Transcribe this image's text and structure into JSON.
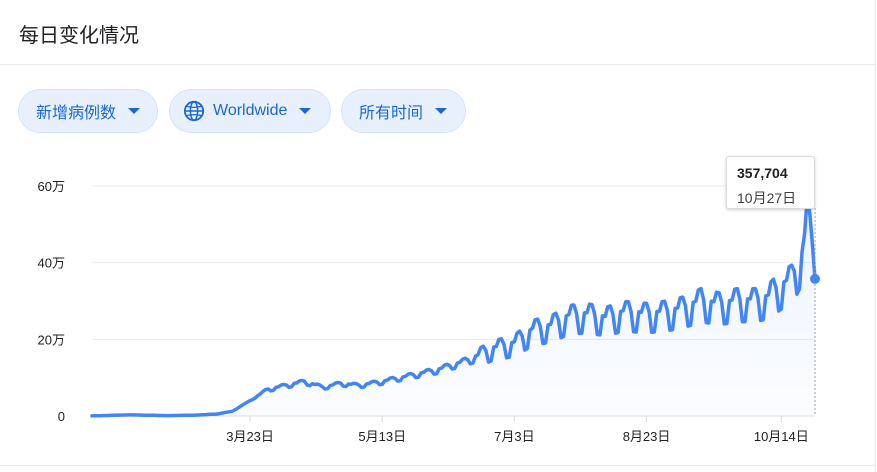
{
  "header": {
    "title": "每日变化情况"
  },
  "filters": {
    "metric": "新增病例数",
    "region": "Worldwide",
    "range": "所有时间"
  },
  "colors": {
    "line": "#4285f4",
    "accent": "#1967d2",
    "chip_bg": "#e8f0fe"
  },
  "icons": {
    "region": "globe-icon",
    "dropdown": "caret-down-icon"
  },
  "tooltip": {
    "value": "357,704",
    "date": "10月27日"
  },
  "chart_data": {
    "type": "area",
    "title": "",
    "xlabel": "",
    "ylabel": "",
    "x_ticks": [
      "3月23日",
      "5月13日",
      "7月3日",
      "8月23日",
      "10月14日"
    ],
    "y_ticks": [
      {
        "value": 0,
        "label": "0"
      },
      {
        "value": 200000,
        "label": "20万"
      },
      {
        "value": 400000,
        "label": "40万"
      },
      {
        "value": 600000,
        "label": "60万"
      }
    ],
    "ylim": [
      0,
      600000
    ],
    "xlim": [
      "2020-01-22",
      "2020-10-27"
    ],
    "grid": "horizontal",
    "series": [
      {
        "x": [
          "2020-01-22",
          "2020-02-05",
          "2020-02-13",
          "2020-02-20",
          "2020-03-01",
          "2020-03-10",
          "2020-03-16",
          "2020-03-23",
          "2020-03-30",
          "2020-04-06",
          "2020-04-13",
          "2020-04-20",
          "2020-04-27",
          "2020-05-04",
          "2020-05-13",
          "2020-05-20",
          "2020-05-27",
          "2020-06-03",
          "2020-06-10",
          "2020-06-17",
          "2020-06-24",
          "2020-07-03",
          "2020-07-10",
          "2020-07-17",
          "2020-07-24",
          "2020-07-31",
          "2020-08-07",
          "2020-08-14",
          "2020-08-23",
          "2020-08-30",
          "2020-09-06",
          "2020-09-13",
          "2020-09-20",
          "2020-09-27",
          "2020-10-04",
          "2020-10-09",
          "2020-10-14",
          "2020-10-18",
          "2020-10-22",
          "2020-10-24",
          "2020-10-26",
          "2020-10-27"
        ],
        "y": [
          200,
          3000,
          2000,
          1000,
          2000,
          5000,
          12000,
          40000,
          70000,
          80000,
          90000,
          75000,
          85000,
          80000,
          90000,
          100000,
          110000,
          120000,
          135000,
          150000,
          175000,
          190000,
          225000,
          235000,
          260000,
          265000,
          255000,
          270000,
          265000,
          270000,
          280000,
          300000,
          290000,
          300000,
          300000,
          310000,
          340000,
          355000,
          420000,
          515000,
          440000,
          357704
        ]
      }
    ]
  }
}
